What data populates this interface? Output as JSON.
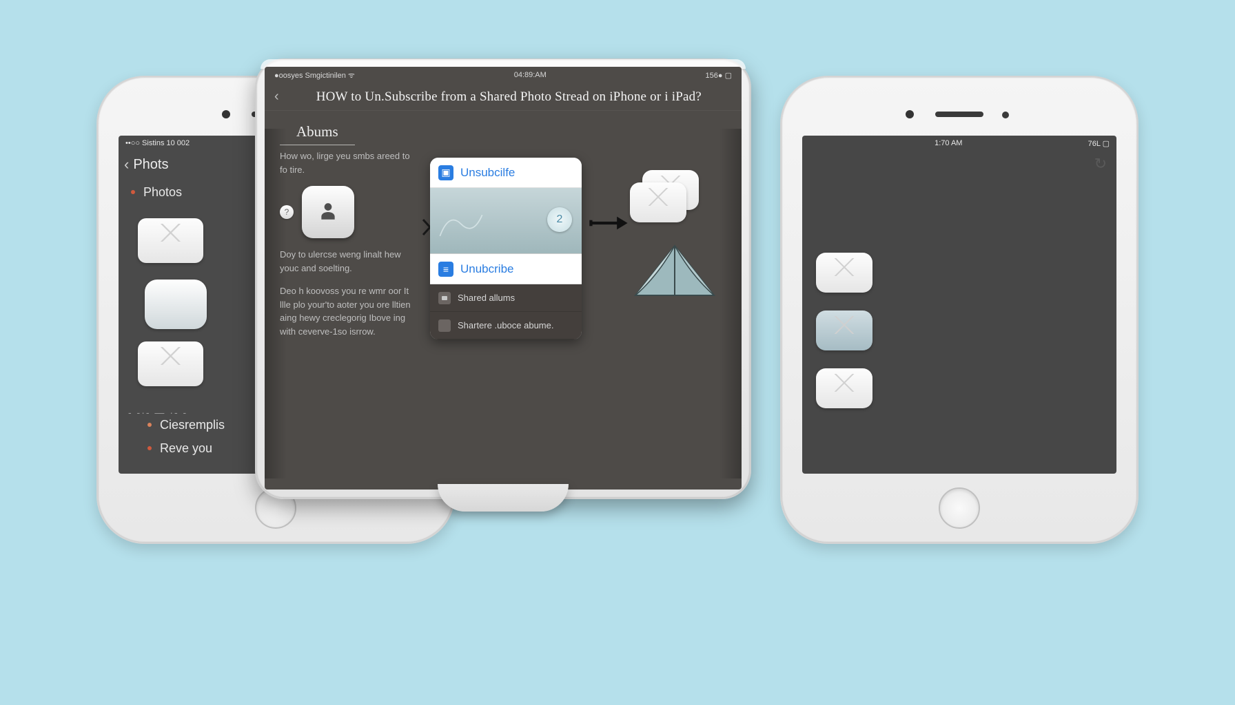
{
  "iphone_left": {
    "status_left": "••○○ Sistins  10 002",
    "nav_back_label": "Phots",
    "list_item_photos": "Photos",
    "divider_dots": "- -·- — ·- -",
    "bottom_item_1": "Ciesremplis",
    "bottom_item_2": "Reve you",
    "dot_color_1": "#d9835c",
    "dot_color_2": "#d05a3d"
  },
  "iphone_right": {
    "status_center": "1:70 AM",
    "status_right": "76L ▢",
    "refresh_glyph": "↻"
  },
  "ipad": {
    "status_left": "●oosyes Smgictinilen ᯤ",
    "status_center": "04:89:AM",
    "status_right": "156● ▢",
    "title": "HOW to Un.Subscribe from a Shared Photo Stread on iPhone or i  iPad?",
    "section": "Abums",
    "left_text_1": "How wo, lirge yeu smbs areed to fo tire.",
    "left_text_2": "Doy to ulercse weng linalt hew youc and soelting.",
    "left_text_3": "Deo h koovoss you re wmr oor It llle plo your'to aoter you ore lltien aing hewy creclegorig Ibove ing with ceverve-1so isrrow.",
    "card_item_1": "Unsubcilfe",
    "card_item_2": "Unubcribe",
    "card_sub_1": "Shared allums",
    "card_sub_2": "Shartere .uboce abume.",
    "bubble_num": "2",
    "icon_color_1": "#2a7de1",
    "icon_color_2": "#2a7de1"
  }
}
